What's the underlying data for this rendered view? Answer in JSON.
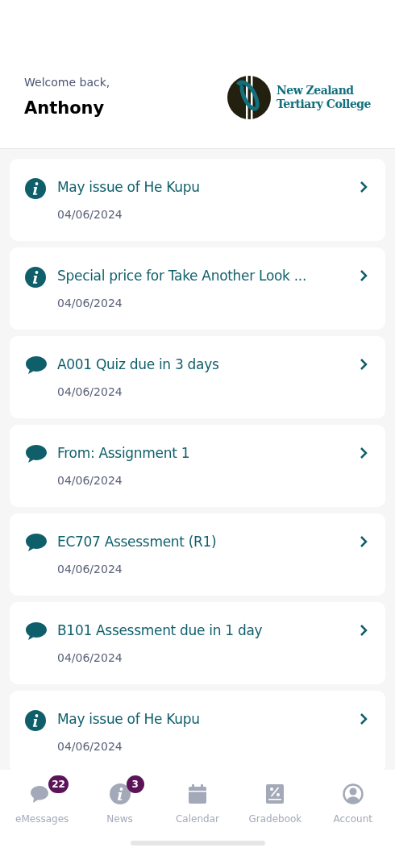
{
  "header": {
    "greeting": "Welcome back,",
    "name": "Anthony",
    "logo_lines": [
      "New Zealand",
      "Tertiary College"
    ]
  },
  "messages": [
    {
      "kind": "info",
      "title": "May issue of He Kupu",
      "date": "04/06/2024"
    },
    {
      "kind": "info",
      "title": "Special price for Take Another Look ...",
      "date": "04/06/2024"
    },
    {
      "kind": "message",
      "title": "A001 Quiz due in 3 days",
      "date": "04/06/2024"
    },
    {
      "kind": "message",
      "title": "From: Assignment 1",
      "date": "04/06/2024"
    },
    {
      "kind": "message",
      "title": "EC707 Assessment (R1)",
      "date": "04/06/2024"
    },
    {
      "kind": "message",
      "title": "B101 Assessment due in 1 day",
      "date": "04/06/2024"
    },
    {
      "kind": "info",
      "title": "May issue of He Kupu",
      "date": "04/06/2024"
    }
  ],
  "nav": [
    {
      "kind": "messages",
      "label": "eMessages",
      "badge": "22"
    },
    {
      "kind": "news",
      "label": "News",
      "badge": "3"
    },
    {
      "kind": "calendar",
      "label": "Calendar"
    },
    {
      "kind": "gradebook",
      "label": "Gradebook"
    },
    {
      "kind": "account",
      "label": "Account"
    }
  ]
}
